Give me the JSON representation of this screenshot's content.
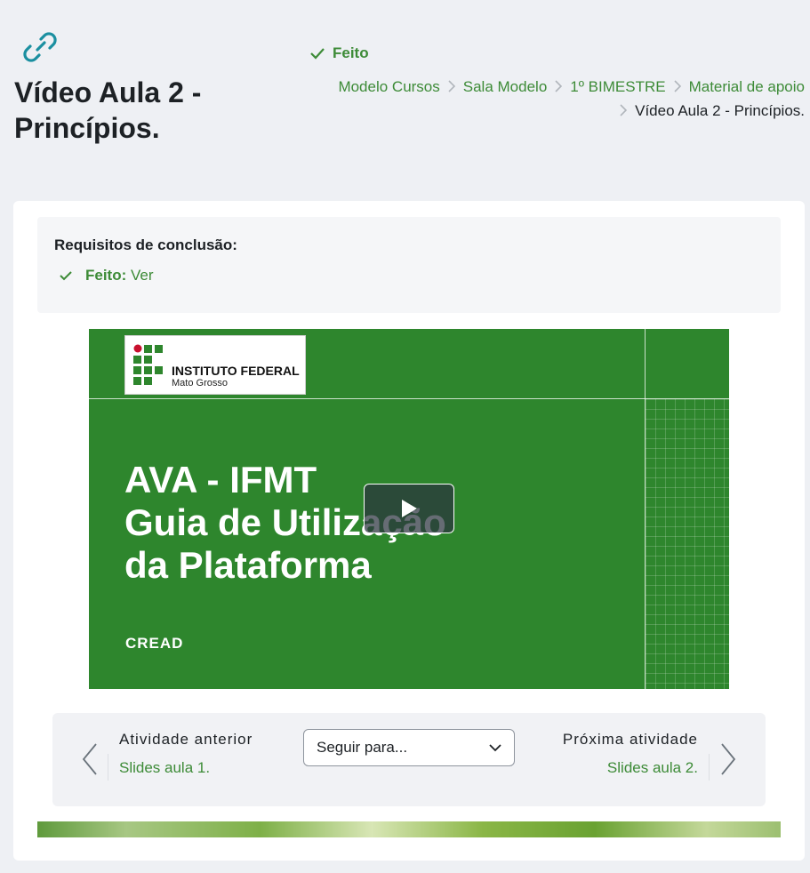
{
  "header": {
    "title": "Vídeo Aula 2 - Princípios.",
    "status": "Feito"
  },
  "breadcrumb": {
    "items": [
      "Modelo Cursos",
      "Sala Modelo",
      "1º BIMESTRE",
      "Material de apoio"
    ],
    "current": "Vídeo Aula 2 - Princípios."
  },
  "completion": {
    "title": "Requisitos de conclusão:",
    "item_status": "Feito:",
    "item_action": "Ver"
  },
  "video": {
    "logo_name": "INSTITUTO FEDERAL",
    "logo_sub": "Mato Grosso",
    "title_lines": [
      "AVA - IFMT",
      "Guia de Utilização",
      "da Plataforma"
    ],
    "footer": "CREAD"
  },
  "navigation": {
    "prev_label": "Atividade anterior",
    "prev_link": "Slides aula 1.",
    "jump_placeholder": "Seguir para...",
    "next_label": "Próxima atividade",
    "next_link": "Slides aula 2."
  },
  "colors": {
    "accent_green": "#3d8b37",
    "video_green": "#2e862d",
    "link_icon": "#1a8fa0"
  }
}
